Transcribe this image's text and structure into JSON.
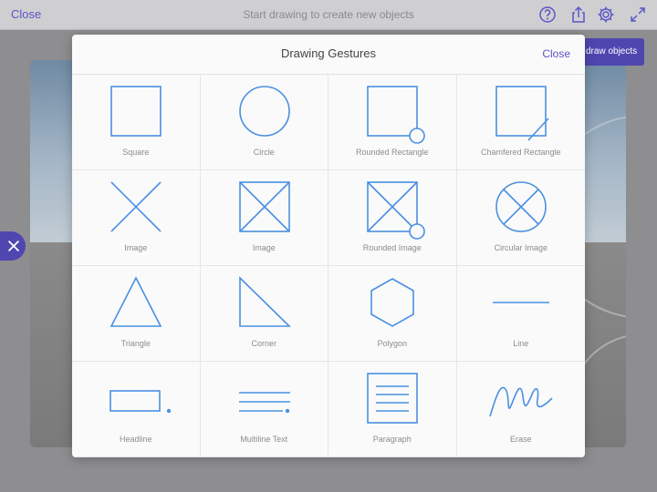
{
  "topbar": {
    "close_label": "Close",
    "hint": "Start drawing to create new objects",
    "icons": [
      "help-icon",
      "share-icon",
      "gear-icon",
      "expand-icon"
    ]
  },
  "background": {
    "draw_objects_button": "draw objects"
  },
  "modal": {
    "title": "Drawing Gestures",
    "close_label": "Close",
    "gestures": [
      {
        "label": "Square",
        "icon": "square-icon"
      },
      {
        "label": "Circle",
        "icon": "circle-icon"
      },
      {
        "label": "Rounded Rectangle",
        "icon": "rounded-rectangle-icon"
      },
      {
        "label": "Chamfered Rectangle",
        "icon": "chamfered-rectangle-icon"
      },
      {
        "label": "Image",
        "icon": "x-image-icon"
      },
      {
        "label": "Image",
        "icon": "boxed-x-image-icon"
      },
      {
        "label": "Rounded Image",
        "icon": "rounded-image-icon"
      },
      {
        "label": "Circular Image",
        "icon": "circular-image-icon"
      },
      {
        "label": "Triangle",
        "icon": "triangle-icon"
      },
      {
        "label": "Corner",
        "icon": "corner-icon"
      },
      {
        "label": "Polygon",
        "icon": "polygon-icon"
      },
      {
        "label": "Line",
        "icon": "line-icon"
      },
      {
        "label": "Headline",
        "icon": "headline-icon"
      },
      {
        "label": "Multiline Text",
        "icon": "multiline-text-icon"
      },
      {
        "label": "Paragraph",
        "icon": "paragraph-icon"
      },
      {
        "label": "Erase",
        "icon": "erase-icon"
      }
    ]
  },
  "colors": {
    "accent": "#5a55c8",
    "gesture_stroke": "#4a90e2"
  }
}
